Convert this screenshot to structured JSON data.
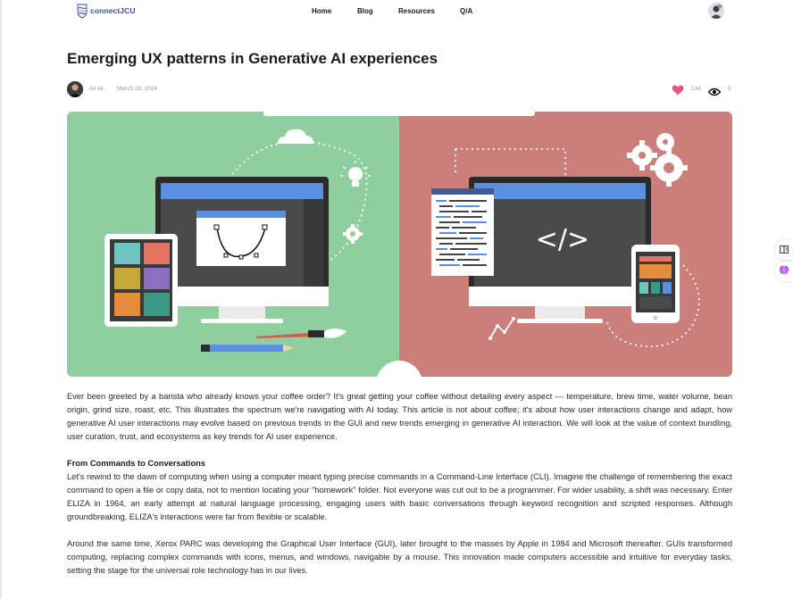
{
  "brand": {
    "name": "connectJCU"
  },
  "nav": {
    "items": [
      "Home",
      "Blog",
      "Resources",
      "Q/A"
    ]
  },
  "article": {
    "title": "Emerging UX patterns in Generative AI experiences",
    "author": "Ak kk",
    "date": "March 28, 2024",
    "likes": "134",
    "views": "9",
    "intro": "Ever been greeted by a barista who already knows your coffee order? It's great getting your coffee without detailing every aspect — temperature, brew time, water volume, bean origin, grind size, roast, etc. This illustrates the spectrum we're navigating with AI today. This article is not about coffee; it's about how user interactions change and adapt, how generative AI user interactions may evolve based on previous trends in the GUI and new trends emerging in generative AI interaction. We will look at the value of context bundling, user curation, trust, and ecosystems as key trends for AI user experience.",
    "section_heading": "From Commands to Conversations",
    "section_p1": "Let's rewind to the dawn of computing when using a computer meant typing precise commands in a Command-Line Interface (CLI). Imagine the challenge of remembering the exact command to open a file or copy data, not to mention locating your \"homework\" folder. Not everyone was cut out to be a programmer. For wider usability, a shift was necessary. Enter ELIZA in 1964, an early attempt at natural language processing, engaging users with basic conversations through keyword recognition and scripted responses. Although groundbreaking, ELIZA's interactions were far from flexible or scalable.",
    "section_p2": "Around the same time, Xerox PARC was developing the Graphical User Interface (GUI), later brought to the masses by Apple in 1984 and Microsoft thereafter. GUIs transformed computing, replacing complex commands with icons, menus, and windows, navigable by a mouse. This innovation made computers accessible and intuitive for everyday tasks, setting the stage for the universal role technology has in our lives."
  },
  "hero": {
    "code_symbol": "</>",
    "colors": {
      "left_bg": "#8fcf9f",
      "right_bg": "#cc7f7a",
      "screen_bar": "#5b8fe0"
    }
  },
  "icons": [
    "logo-icon",
    "heart-icon",
    "eye-icon",
    "reader-icon",
    "brain-icon",
    "profile-avatar"
  ],
  "colors": {
    "accent": "#3b4fb0",
    "like": "#e8547e",
    "text": "#2a2a2a",
    "muted": "#9a9a9a"
  }
}
